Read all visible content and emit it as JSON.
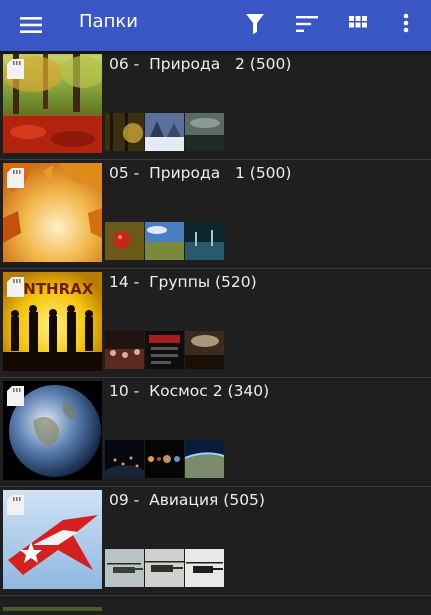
{
  "appbar": {
    "title": "Папки",
    "menu_icon": "hamburger-menu-icon",
    "actions": [
      "filter-icon",
      "sort-icon",
      "grid-view-icon",
      "more-vert-icon"
    ],
    "color": "#3a56c5"
  },
  "folders": [
    {
      "name": "06 -  Природа   2 (500)",
      "storage_icon": "sd-card-icon",
      "cover": "autumn-forest",
      "thumbs": [
        "sunlit-trees",
        "snowy-forest",
        "dark-landscape"
      ]
    },
    {
      "name": "05 -  Природа   1 (500)",
      "storage_icon": "sd-card-icon",
      "cover": "autumn-leaves",
      "thumbs": [
        "red-berry",
        "field-sky",
        "dark-sky"
      ]
    },
    {
      "name": "14 -  Группы (520)",
      "storage_icon": "sd-card-icon",
      "cover": "anthrax-band",
      "cover_text": "ANTHRAX",
      "thumbs": [
        "concert-crowd",
        "band-poster",
        "stage-crowd"
      ]
    },
    {
      "name": "10 -  Космос 2 (340)",
      "storage_icon": "sd-card-icon",
      "cover": "earth-globe",
      "thumbs": [
        "city-night",
        "planets",
        "earth-orbit"
      ]
    },
    {
      "name": "09 -  Авиация (505)",
      "storage_icon": "sd-card-icon",
      "cover": "red-star-jet",
      "thumbs": [
        "helicopter",
        "apache",
        "helicopter-2"
      ]
    }
  ]
}
